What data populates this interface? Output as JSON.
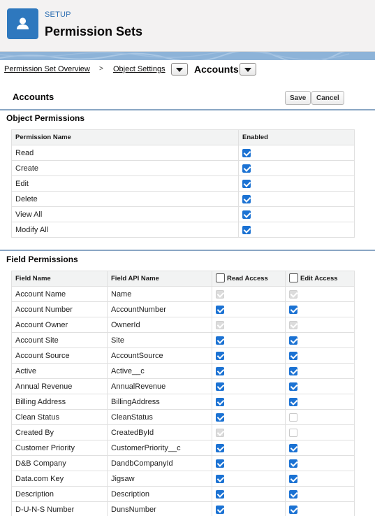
{
  "header": {
    "setup_label": "SETUP",
    "title": "Permission Sets",
    "icon": "user-icon",
    "accent_color": "#2e78be"
  },
  "breadcrumb": {
    "overview_link": "Permission Set Overview",
    "separator": ">",
    "object_settings_link": "Object Settings",
    "current": "Accounts"
  },
  "object_header": {
    "title": "Accounts",
    "save_label": "Save",
    "cancel_label": "Cancel"
  },
  "object_permissions": {
    "section_title": "Object Permissions",
    "col_name": "Permission Name",
    "col_enabled": "Enabled",
    "rows": [
      {
        "name": "Read",
        "enabled": "on"
      },
      {
        "name": "Create",
        "enabled": "on"
      },
      {
        "name": "Edit",
        "enabled": "on"
      },
      {
        "name": "Delete",
        "enabled": "on"
      },
      {
        "name": "View All",
        "enabled": "on"
      },
      {
        "name": "Modify All",
        "enabled": "on"
      }
    ]
  },
  "field_permissions": {
    "section_title": "Field Permissions",
    "col_field_name": "Field Name",
    "col_api_name": "Field API Name",
    "col_read": "Read Access",
    "col_edit": "Edit Access",
    "rows": [
      {
        "name": "Account Name",
        "api": "Name",
        "read": "dis",
        "edit": "dis"
      },
      {
        "name": "Account Number",
        "api": "AccountNumber",
        "read": "on",
        "edit": "on"
      },
      {
        "name": "Account Owner",
        "api": "OwnerId",
        "read": "dis",
        "edit": "dis"
      },
      {
        "name": "Account Site",
        "api": "Site",
        "read": "on",
        "edit": "on"
      },
      {
        "name": "Account Source",
        "api": "AccountSource",
        "read": "on",
        "edit": "on"
      },
      {
        "name": "Active",
        "api": "Active__c",
        "read": "on",
        "edit": "on"
      },
      {
        "name": "Annual Revenue",
        "api": "AnnualRevenue",
        "read": "on",
        "edit": "on"
      },
      {
        "name": "Billing Address",
        "api": "BillingAddress",
        "read": "on",
        "edit": "on"
      },
      {
        "name": "Clean Status",
        "api": "CleanStatus",
        "read": "on",
        "edit": "off-dis"
      },
      {
        "name": "Created By",
        "api": "CreatedById",
        "read": "dis",
        "edit": "off-dis"
      },
      {
        "name": "Customer Priority",
        "api": "CustomerPriority__c",
        "read": "on",
        "edit": "on"
      },
      {
        "name": "D&B Company",
        "api": "DandbCompanyId",
        "read": "on",
        "edit": "on"
      },
      {
        "name": "Data.com Key",
        "api": "Jigsaw",
        "read": "on",
        "edit": "on"
      },
      {
        "name": "Description",
        "api": "Description",
        "read": "on",
        "edit": "on"
      },
      {
        "name": "D-U-N-S Number",
        "api": "DunsNumber",
        "read": "on",
        "edit": "on"
      }
    ]
  }
}
